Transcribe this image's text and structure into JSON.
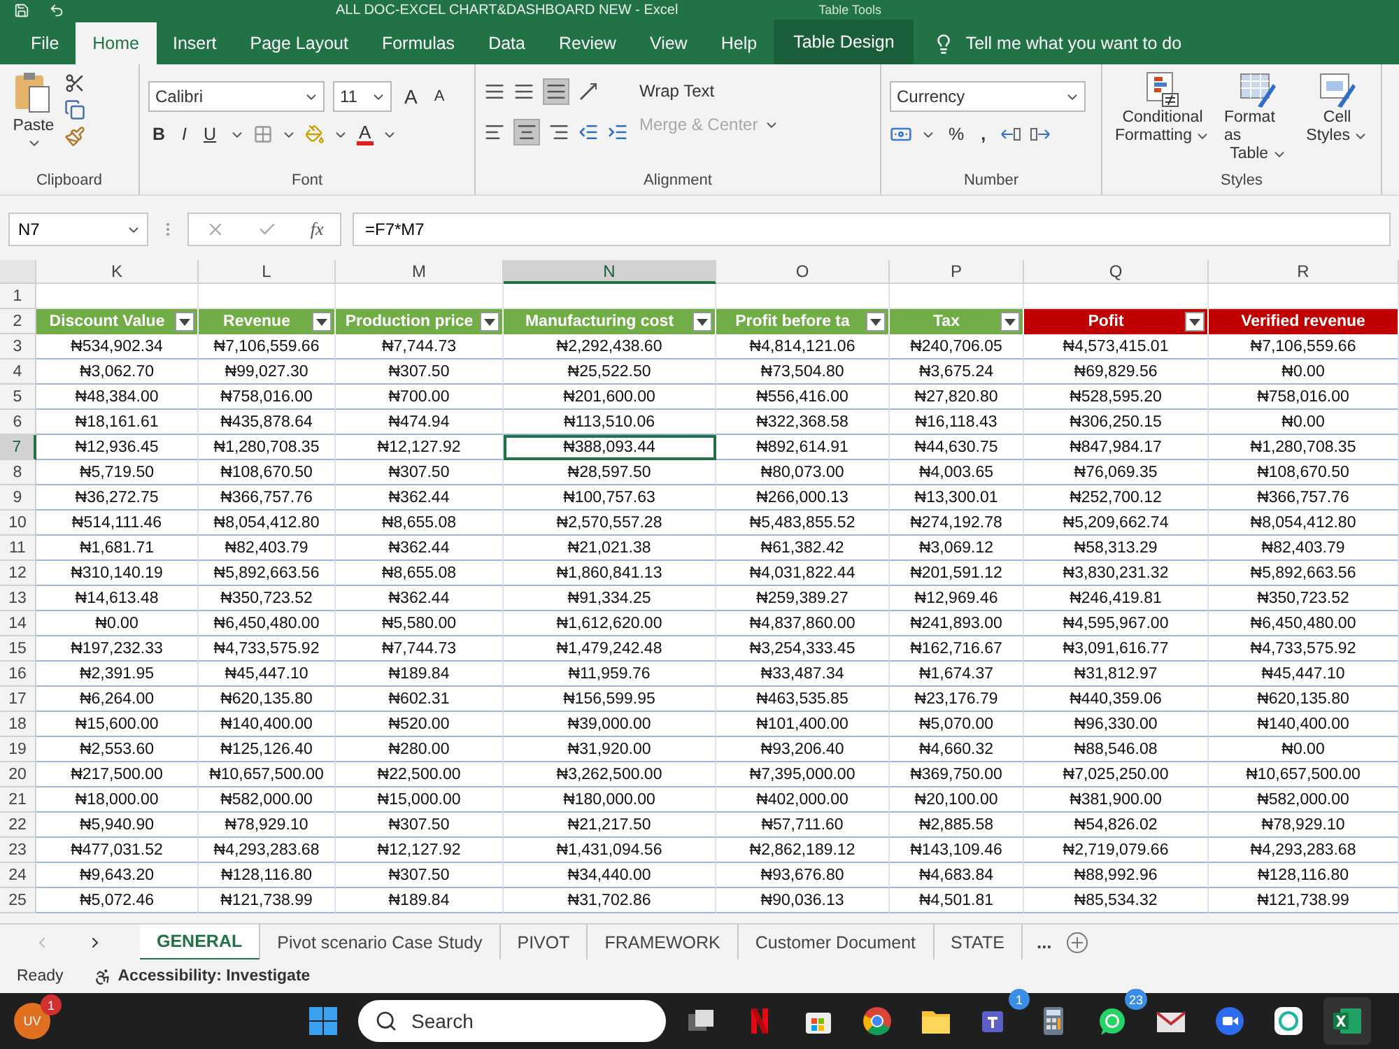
{
  "title_bar": {
    "title": "ALL DOC-EXCEL CHART&DASHBOARD NEW  -  Excel",
    "context_label": "Table Tools"
  },
  "ribbon_tabs": [
    {
      "label": "File",
      "selected": false,
      "kind": "normal"
    },
    {
      "label": "Home",
      "selected": true,
      "kind": "normal"
    },
    {
      "label": "Insert",
      "selected": false,
      "kind": "normal"
    },
    {
      "label": "Page Layout",
      "selected": false,
      "kind": "normal"
    },
    {
      "label": "Formulas",
      "selected": false,
      "kind": "normal"
    },
    {
      "label": "Data",
      "selected": false,
      "kind": "normal"
    },
    {
      "label": "Review",
      "selected": false,
      "kind": "normal"
    },
    {
      "label": "View",
      "selected": false,
      "kind": "normal"
    },
    {
      "label": "Help",
      "selected": false,
      "kind": "normal"
    },
    {
      "label": "Table Design",
      "selected": false,
      "kind": "contextual"
    }
  ],
  "tell_me": "Tell me what you want to do",
  "ribbon": {
    "clipboard": {
      "paste": "Paste",
      "label": "Clipboard"
    },
    "font": {
      "name": "Calibri",
      "size": "11",
      "grow": "A",
      "shrink": "A",
      "bold": "B",
      "italic": "I",
      "underline": "U",
      "font_color": "A",
      "label": "Font"
    },
    "alignment": {
      "wrap_text": "Wrap Text",
      "merge_center": "Merge & Center",
      "merge_disabled": true,
      "label": "Alignment"
    },
    "number": {
      "format": "Currency",
      "percent": "%",
      "comma": ",",
      "label": "Number"
    },
    "styles": {
      "buttons": [
        {
          "line1": "Conditional",
          "line2": "Formatting",
          "kind": "conditional"
        },
        {
          "line1": "Format as",
          "line2": "Table",
          "kind": "table"
        },
        {
          "line1": "Cell",
          "line2": "Styles",
          "kind": "cell"
        }
      ],
      "label": "Styles"
    }
  },
  "formula_bar": {
    "name_box": "N7",
    "function_label": "fx",
    "formula": "=F7*M7"
  },
  "sheet": {
    "columns": [
      {
        "letter": "K",
        "header": "Discount Value",
        "color": "#70ad47",
        "filter": true,
        "selected": false
      },
      {
        "letter": "L",
        "header": "Revenue",
        "color": "#70ad47",
        "filter": true,
        "selected": false
      },
      {
        "letter": "M",
        "header": "Production price",
        "color": "#70ad47",
        "filter": true,
        "selected": false
      },
      {
        "letter": "N",
        "header": "Manufacturing cost",
        "color": "#70ad47",
        "filter": true,
        "selected": true
      },
      {
        "letter": "O",
        "header": "Profit before ta",
        "color": "#70ad47",
        "filter": true,
        "selected": false
      },
      {
        "letter": "P",
        "header": "Tax",
        "color": "#70ad47",
        "filter": true,
        "selected": false
      },
      {
        "letter": "Q",
        "header": "Pofit",
        "color": "#c00000",
        "filter": true,
        "selected": false
      },
      {
        "letter": "R",
        "header": "Verified revenue",
        "color": "#c00000",
        "filter": false,
        "selected": false
      }
    ],
    "rows": [
      {
        "number": "1",
        "kind": "blank",
        "selected": false
      },
      {
        "number": "2",
        "kind": "header",
        "selected": false
      },
      {
        "number": "3",
        "kind": "data",
        "selected": false,
        "cells": [
          "₦534,902.34",
          "₦7,106,559.66",
          "₦7,744.73",
          "₦2,292,438.60",
          "₦4,814,121.06",
          "₦240,706.05",
          "₦4,573,415.01",
          "₦7,106,559.66"
        ]
      },
      {
        "number": "4",
        "kind": "data",
        "selected": false,
        "cells": [
          "₦3,062.70",
          "₦99,027.30",
          "₦307.50",
          "₦25,522.50",
          "₦73,504.80",
          "₦3,675.24",
          "₦69,829.56",
          "₦0.00"
        ]
      },
      {
        "number": "5",
        "kind": "data",
        "selected": false,
        "cells": [
          "₦48,384.00",
          "₦758,016.00",
          "₦700.00",
          "₦201,600.00",
          "₦556,416.00",
          "₦27,820.80",
          "₦528,595.20",
          "₦758,016.00"
        ]
      },
      {
        "number": "6",
        "kind": "data",
        "selected": false,
        "cells": [
          "₦18,161.61",
          "₦435,878.64",
          "₦474.94",
          "₦113,510.06",
          "₦322,368.58",
          "₦16,118.43",
          "₦306,250.15",
          "₦0.00"
        ]
      },
      {
        "number": "7",
        "kind": "data",
        "selected": true,
        "cells": [
          "₦12,936.45",
          "₦1,280,708.35",
          "₦12,127.92",
          "₦388,093.44",
          "₦892,614.91",
          "₦44,630.75",
          "₦847,984.17",
          "₦1,280,708.35"
        ]
      },
      {
        "number": "8",
        "kind": "data",
        "selected": false,
        "cells": [
          "₦5,719.50",
          "₦108,670.50",
          "₦307.50",
          "₦28,597.50",
          "₦80,073.00",
          "₦4,003.65",
          "₦76,069.35",
          "₦108,670.50"
        ]
      },
      {
        "number": "9",
        "kind": "data",
        "selected": false,
        "cells": [
          "₦36,272.75",
          "₦366,757.76",
          "₦362.44",
          "₦100,757.63",
          "₦266,000.13",
          "₦13,300.01",
          "₦252,700.12",
          "₦366,757.76"
        ]
      },
      {
        "number": "10",
        "kind": "data",
        "selected": false,
        "cells": [
          "₦514,111.46",
          "₦8,054,412.80",
          "₦8,655.08",
          "₦2,570,557.28",
          "₦5,483,855.52",
          "₦274,192.78",
          "₦5,209,662.74",
          "₦8,054,412.80"
        ]
      },
      {
        "number": "11",
        "kind": "data",
        "selected": false,
        "cells": [
          "₦1,681.71",
          "₦82,403.79",
          "₦362.44",
          "₦21,021.38",
          "₦61,382.42",
          "₦3,069.12",
          "₦58,313.29",
          "₦82,403.79"
        ]
      },
      {
        "number": "12",
        "kind": "data",
        "selected": false,
        "cells": [
          "₦310,140.19",
          "₦5,892,663.56",
          "₦8,655.08",
          "₦1,860,841.13",
          "₦4,031,822.44",
          "₦201,591.12",
          "₦3,830,231.32",
          "₦5,892,663.56"
        ]
      },
      {
        "number": "13",
        "kind": "data",
        "selected": false,
        "cells": [
          "₦14,613.48",
          "₦350,723.52",
          "₦362.44",
          "₦91,334.25",
          "₦259,389.27",
          "₦12,969.46",
          "₦246,419.81",
          "₦350,723.52"
        ]
      },
      {
        "number": "14",
        "kind": "data",
        "selected": false,
        "cells": [
          "₦0.00",
          "₦6,450,480.00",
          "₦5,580.00",
          "₦1,612,620.00",
          "₦4,837,860.00",
          "₦241,893.00",
          "₦4,595,967.00",
          "₦6,450,480.00"
        ]
      },
      {
        "number": "15",
        "kind": "data",
        "selected": false,
        "cells": [
          "₦197,232.33",
          "₦4,733,575.92",
          "₦7,744.73",
          "₦1,479,242.48",
          "₦3,254,333.45",
          "₦162,716.67",
          "₦3,091,616.77",
          "₦4,733,575.92"
        ]
      },
      {
        "number": "16",
        "kind": "data",
        "selected": false,
        "cells": [
          "₦2,391.95",
          "₦45,447.10",
          "₦189.84",
          "₦11,959.76",
          "₦33,487.34",
          "₦1,674.37",
          "₦31,812.97",
          "₦45,447.10"
        ]
      },
      {
        "number": "17",
        "kind": "data",
        "selected": false,
        "cells": [
          "₦6,264.00",
          "₦620,135.80",
          "₦602.31",
          "₦156,599.95",
          "₦463,535.85",
          "₦23,176.79",
          "₦440,359.06",
          "₦620,135.80"
        ]
      },
      {
        "number": "18",
        "kind": "data",
        "selected": false,
        "cells": [
          "₦15,600.00",
          "₦140,400.00",
          "₦520.00",
          "₦39,000.00",
          "₦101,400.00",
          "₦5,070.00",
          "₦96,330.00",
          "₦140,400.00"
        ]
      },
      {
        "number": "19",
        "kind": "data",
        "selected": false,
        "cells": [
          "₦2,553.60",
          "₦125,126.40",
          "₦280.00",
          "₦31,920.00",
          "₦93,206.40",
          "₦4,660.32",
          "₦88,546.08",
          "₦0.00"
        ]
      },
      {
        "number": "20",
        "kind": "data",
        "selected": false,
        "cells": [
          "₦217,500.00",
          "₦10,657,500.00",
          "₦22,500.00",
          "₦3,262,500.00",
          "₦7,395,000.00",
          "₦369,750.00",
          "₦7,025,250.00",
          "₦10,657,500.00"
        ]
      },
      {
        "number": "21",
        "kind": "data",
        "selected": false,
        "cells": [
          "₦18,000.00",
          "₦582,000.00",
          "₦15,000.00",
          "₦180,000.00",
          "₦402,000.00",
          "₦20,100.00",
          "₦381,900.00",
          "₦582,000.00"
        ]
      },
      {
        "number": "22",
        "kind": "data",
        "selected": false,
        "cells": [
          "₦5,940.90",
          "₦78,929.10",
          "₦307.50",
          "₦21,217.50",
          "₦57,711.60",
          "₦2,885.58",
          "₦54,826.02",
          "₦78,929.10"
        ]
      },
      {
        "number": "23",
        "kind": "data",
        "selected": false,
        "cells": [
          "₦477,031.52",
          "₦4,293,283.68",
          "₦12,127.92",
          "₦1,431,094.56",
          "₦2,862,189.12",
          "₦143,109.46",
          "₦2,719,079.66",
          "₦4,293,283.68"
        ]
      },
      {
        "number": "24",
        "kind": "data",
        "selected": false,
        "cells": [
          "₦9,643.20",
          "₦128,116.80",
          "₦307.50",
          "₦34,440.00",
          "₦93,676.80",
          "₦4,683.84",
          "₦88,992.96",
          "₦128,116.80"
        ]
      },
      {
        "number": "25",
        "kind": "data",
        "selected": false,
        "cells": [
          "₦5,072.46",
          "₦121,738.99",
          "₦189.84",
          "₦31,702.86",
          "₦90,036.13",
          "₦4,501.81",
          "₦85,534.32",
          "₦121,738.99"
        ]
      }
    ]
  },
  "sheet_tabs": [
    {
      "label": "GENERAL",
      "selected": true
    },
    {
      "label": "Pivot scenario Case Study",
      "selected": false
    },
    {
      "label": "PIVOT",
      "selected": false
    },
    {
      "label": "FRAMEWORK",
      "selected": false
    },
    {
      "label": "Customer Document",
      "selected": false
    },
    {
      "label": "STATE",
      "selected": false
    }
  ],
  "more_sheets": "...",
  "status_bar": {
    "mode": "Ready",
    "accessibility": "Accessibility: Investigate"
  },
  "taskbar": {
    "avatar": {
      "initials": "UV",
      "badge": "1"
    },
    "search": {
      "placeholder": "Search"
    },
    "apps": [
      {
        "kind": "windows",
        "selected": false
      },
      {
        "kind": "taskview",
        "selected": false
      },
      {
        "kind": "netflix",
        "selected": false
      },
      {
        "kind": "store",
        "selected": false
      },
      {
        "kind": "chrome",
        "selected": false
      },
      {
        "kind": "folder",
        "selected": false
      },
      {
        "kind": "teams",
        "selected": false,
        "badge": "1"
      },
      {
        "kind": "calculator",
        "selected": false
      },
      {
        "kind": "whatsapp",
        "selected": false,
        "badge": "23"
      },
      {
        "kind": "mail",
        "selected": false
      },
      {
        "kind": "zoom",
        "selected": false
      },
      {
        "kind": "chat",
        "selected": false
      },
      {
        "kind": "excel",
        "selected": true
      }
    ]
  }
}
